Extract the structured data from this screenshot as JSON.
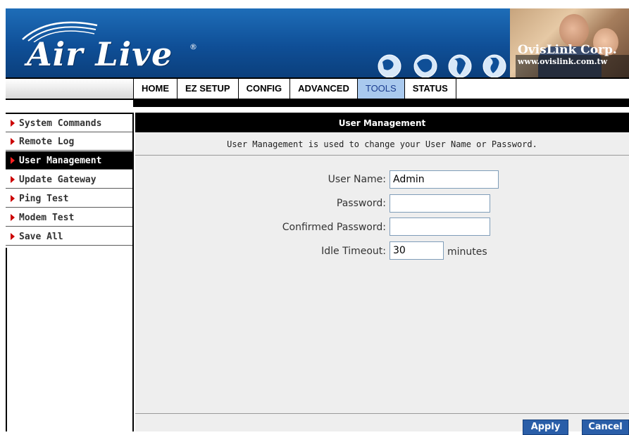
{
  "banner": {
    "logo_text": "Air Live",
    "logo_reg": "®",
    "corp_name": "OvisLink Corp.",
    "corp_url": "www.ovislink.com.tw"
  },
  "nav": {
    "tabs": [
      "HOME",
      "EZ SETUP",
      "CONFIG",
      "ADVANCED",
      "TOOLS",
      "STATUS"
    ],
    "active": "TOOLS"
  },
  "sidebar": {
    "items": [
      "System Commands",
      "Remote Log",
      "User Management",
      "Update Gateway",
      "Ping Test",
      "Modem Test",
      "Save All"
    ],
    "active": "User Management"
  },
  "content": {
    "header": "User Management",
    "description": "User Management is used to change your User Name or Password.",
    "fields": {
      "username_label": "User Name:",
      "username_value": "Admin",
      "password_label": "Password:",
      "password_value": "",
      "confirm_label": "Confirmed Password:",
      "confirm_value": "",
      "idle_label": "Idle Timeout:",
      "idle_value": "30",
      "idle_unit": "minutes"
    },
    "buttons": {
      "apply": "Apply",
      "cancel": "Cancel"
    }
  },
  "colors": {
    "banner_blue": "#1e6db8",
    "active_tab": "#a9c9ee",
    "button_blue": "#2a5ea8",
    "arrow_red": "#cc0000"
  }
}
